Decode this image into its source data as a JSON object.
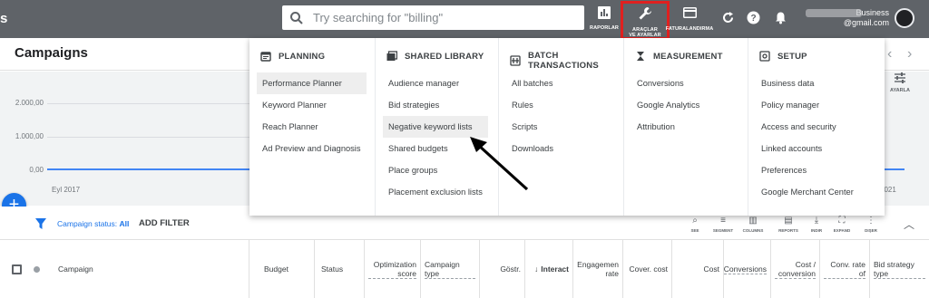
{
  "app": {
    "brand_fragment": "s",
    "search_placeholder": "Try searching for \"billing\"",
    "reports_label": "RAPORLAR",
    "tools_label_1": "ARAÇLAR",
    "tools_label_2": "VE AYARLAR",
    "billing_label": "FATURALANDIRMA",
    "account_line1": "Business",
    "account_line2": "@gmail.com",
    "tools_highlight_color": "#e0201f"
  },
  "page": {
    "title": "Campaigns",
    "adjust_label": "AYARLA"
  },
  "chart": {
    "y_ticks": [
      "2.000,00",
      "1.000,00",
      "0,00"
    ],
    "x_start": "Eyl 2017",
    "x_end": "2021",
    "series_color": "#4285f4"
  },
  "chart_data": {
    "type": "line",
    "x": [
      "Eyl 2017",
      "2021"
    ],
    "series": [
      {
        "values": [
          0,
          0
        ]
      }
    ],
    "ylim": [
      0,
      2000
    ],
    "y_ticks": [
      "2.000,00",
      "1.000,00",
      "0,00"
    ],
    "title": "",
    "xlabel": "",
    "ylabel": ""
  },
  "filter_bar": {
    "status_label": "Campaign status:",
    "status_value": "All",
    "add_filter": "ADD FILTER",
    "toolbar": [
      {
        "icon": "search-icon",
        "glyph": "⌕",
        "label": "SEE"
      },
      {
        "icon": "segment-icon",
        "glyph": "≡",
        "label": "SEGMENT"
      },
      {
        "icon": "columns-icon",
        "glyph": "▥",
        "label": "COLUMNS"
      },
      {
        "icon": "reports-icon",
        "glyph": "▤",
        "label": "REPORTS"
      },
      {
        "icon": "download-icon",
        "glyph": "⤓",
        "label": "INDIR"
      },
      {
        "icon": "expand-icon",
        "glyph": "⛶",
        "label": "EXPAND"
      },
      {
        "icon": "more-icon",
        "glyph": "⋮",
        "label": "DIŞER"
      }
    ]
  },
  "table": {
    "columns": [
      {
        "key": "campaign",
        "label": "Campaign"
      },
      {
        "key": "budget",
        "label": "Budget"
      },
      {
        "key": "status",
        "label": "Status"
      },
      {
        "key": "optimization",
        "label": "Optimization score"
      },
      {
        "key": "type",
        "label": "Campaign type"
      },
      {
        "key": "impr",
        "label": "Göstr."
      },
      {
        "key": "interactions",
        "label": "Interact"
      },
      {
        "key": "engagement",
        "label": "Engagemen rate"
      },
      {
        "key": "cover",
        "label": "Cover. cost"
      },
      {
        "key": "cost",
        "label": "Cost"
      },
      {
        "key": "conversions",
        "label": "Conversions"
      },
      {
        "key": "cost_conv",
        "label": "Cost / conversion"
      },
      {
        "key": "conv_rate",
        "label": "Conv. rate of"
      },
      {
        "key": "bid",
        "label": "Bid strategy type"
      }
    ]
  },
  "menu": {
    "columns": [
      {
        "heading": "PLANNING",
        "icon": "calendar-icon",
        "items": [
          "Performance Planner",
          "Keyword Planner",
          "Reach Planner",
          "Ad Preview and Diagnosis"
        ]
      },
      {
        "heading": "SHARED LIBRARY",
        "icon": "library-icon",
        "items": [
          "Audience manager",
          "Bid strategies",
          "Negative keyword lists",
          "Shared budgets",
          "Place groups",
          "Placement exclusion lists"
        ]
      },
      {
        "heading": "BATCH TRANSACTIONS",
        "icon": "batch-icon",
        "items": [
          "All batches",
          "Rules",
          "Scripts",
          "Downloads"
        ]
      },
      {
        "heading": "MEASUREMENT",
        "icon": "hourglass-icon",
        "items": [
          "Conversions",
          "Google Analytics",
          "Attribution"
        ]
      },
      {
        "heading": "SETUP",
        "icon": "setup-icon",
        "items": [
          "Business data",
          "Policy manager",
          "Access and security",
          "Linked accounts",
          "Preferences",
          "Google Merchant Center"
        ]
      }
    ]
  }
}
